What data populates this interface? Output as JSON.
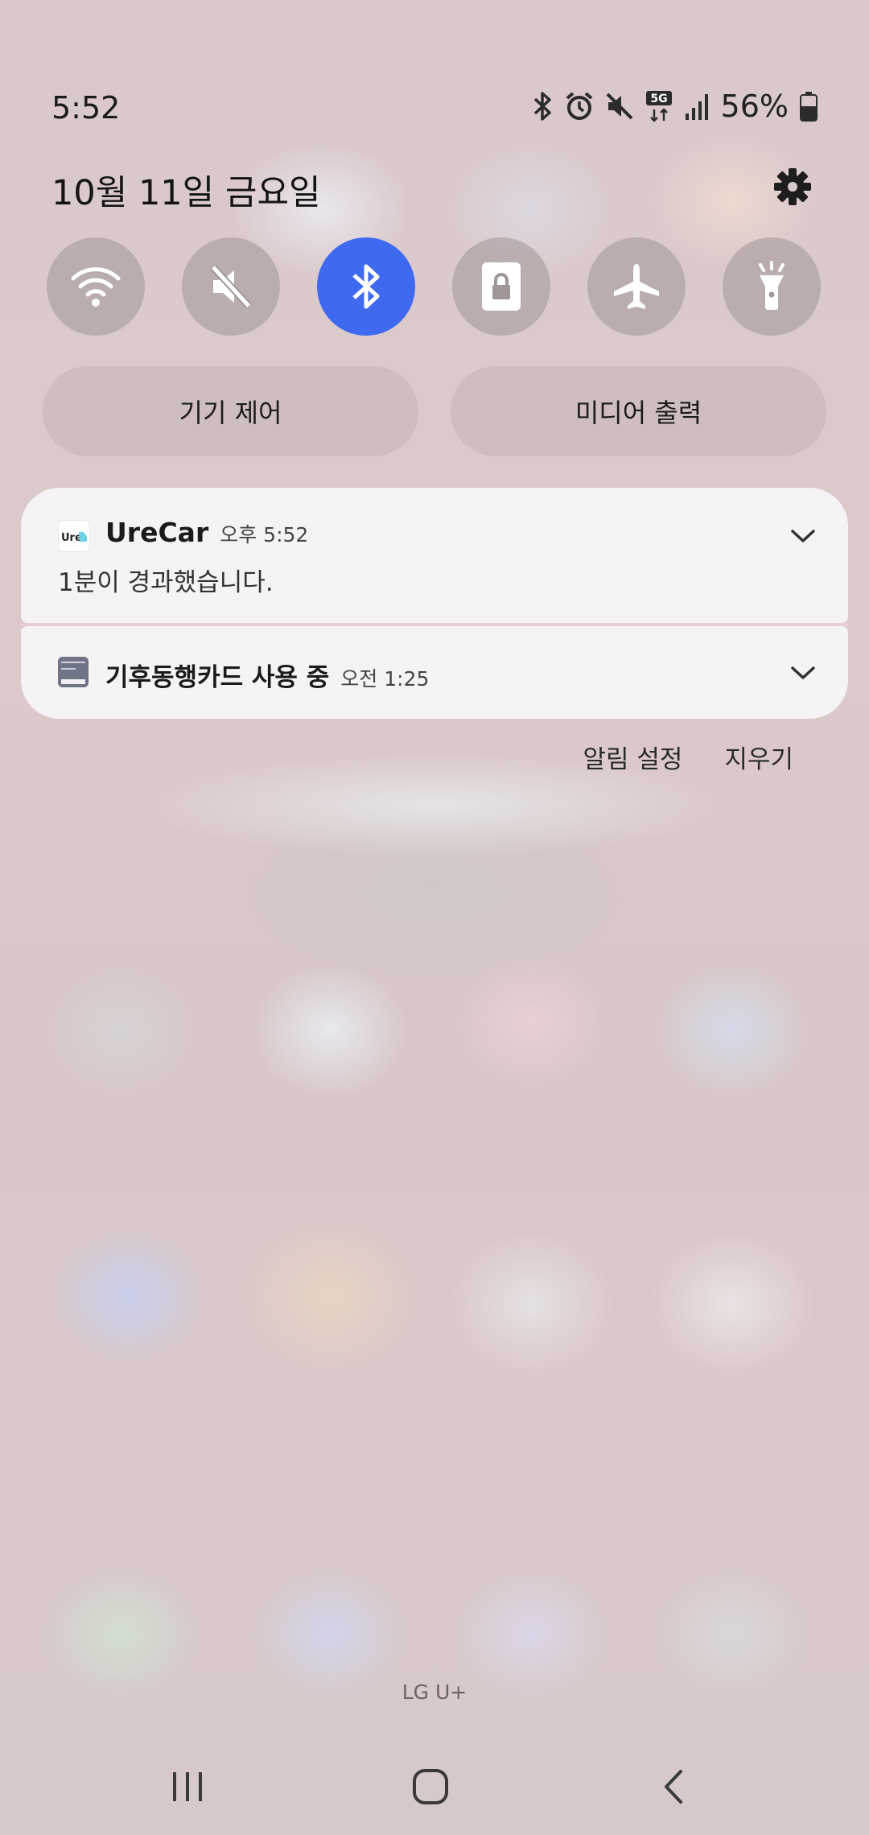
{
  "status_bar": {
    "time": "5:52",
    "battery": "56%",
    "network": "5G",
    "icons": [
      "bluetooth-icon",
      "alarm-icon",
      "mute-icon",
      "5g-data-icon",
      "signal-icon",
      "battery-icon"
    ]
  },
  "header": {
    "date": "10월 11일 금요일"
  },
  "quick_settings": {
    "tiles": [
      {
        "name": "wifi",
        "icon": "wifi-icon",
        "active": false
      },
      {
        "name": "sound",
        "icon": "mute-icon",
        "active": false
      },
      {
        "name": "bluetooth",
        "icon": "bluetooth-icon",
        "active": true
      },
      {
        "name": "rotation-lock",
        "icon": "lock-icon",
        "active": false
      },
      {
        "name": "airplane",
        "icon": "airplane-icon",
        "active": false
      },
      {
        "name": "flashlight",
        "icon": "flashlight-icon",
        "active": false
      }
    ],
    "device_control_label": "기기 제어",
    "media_output_label": "미디어 출력"
  },
  "notifications": [
    {
      "app": "UreCar",
      "time": "오후 5:52",
      "body": "1분이 경과했습니다."
    },
    {
      "app": "기후동행카드 사용 중",
      "time": "오전 1:25"
    }
  ],
  "notification_actions": {
    "settings_label": "알림 설정",
    "clear_label": "지우기"
  },
  "carrier": "LG U+",
  "colors": {
    "accent": "#3f69f0",
    "tile_bg": "#a09696"
  }
}
